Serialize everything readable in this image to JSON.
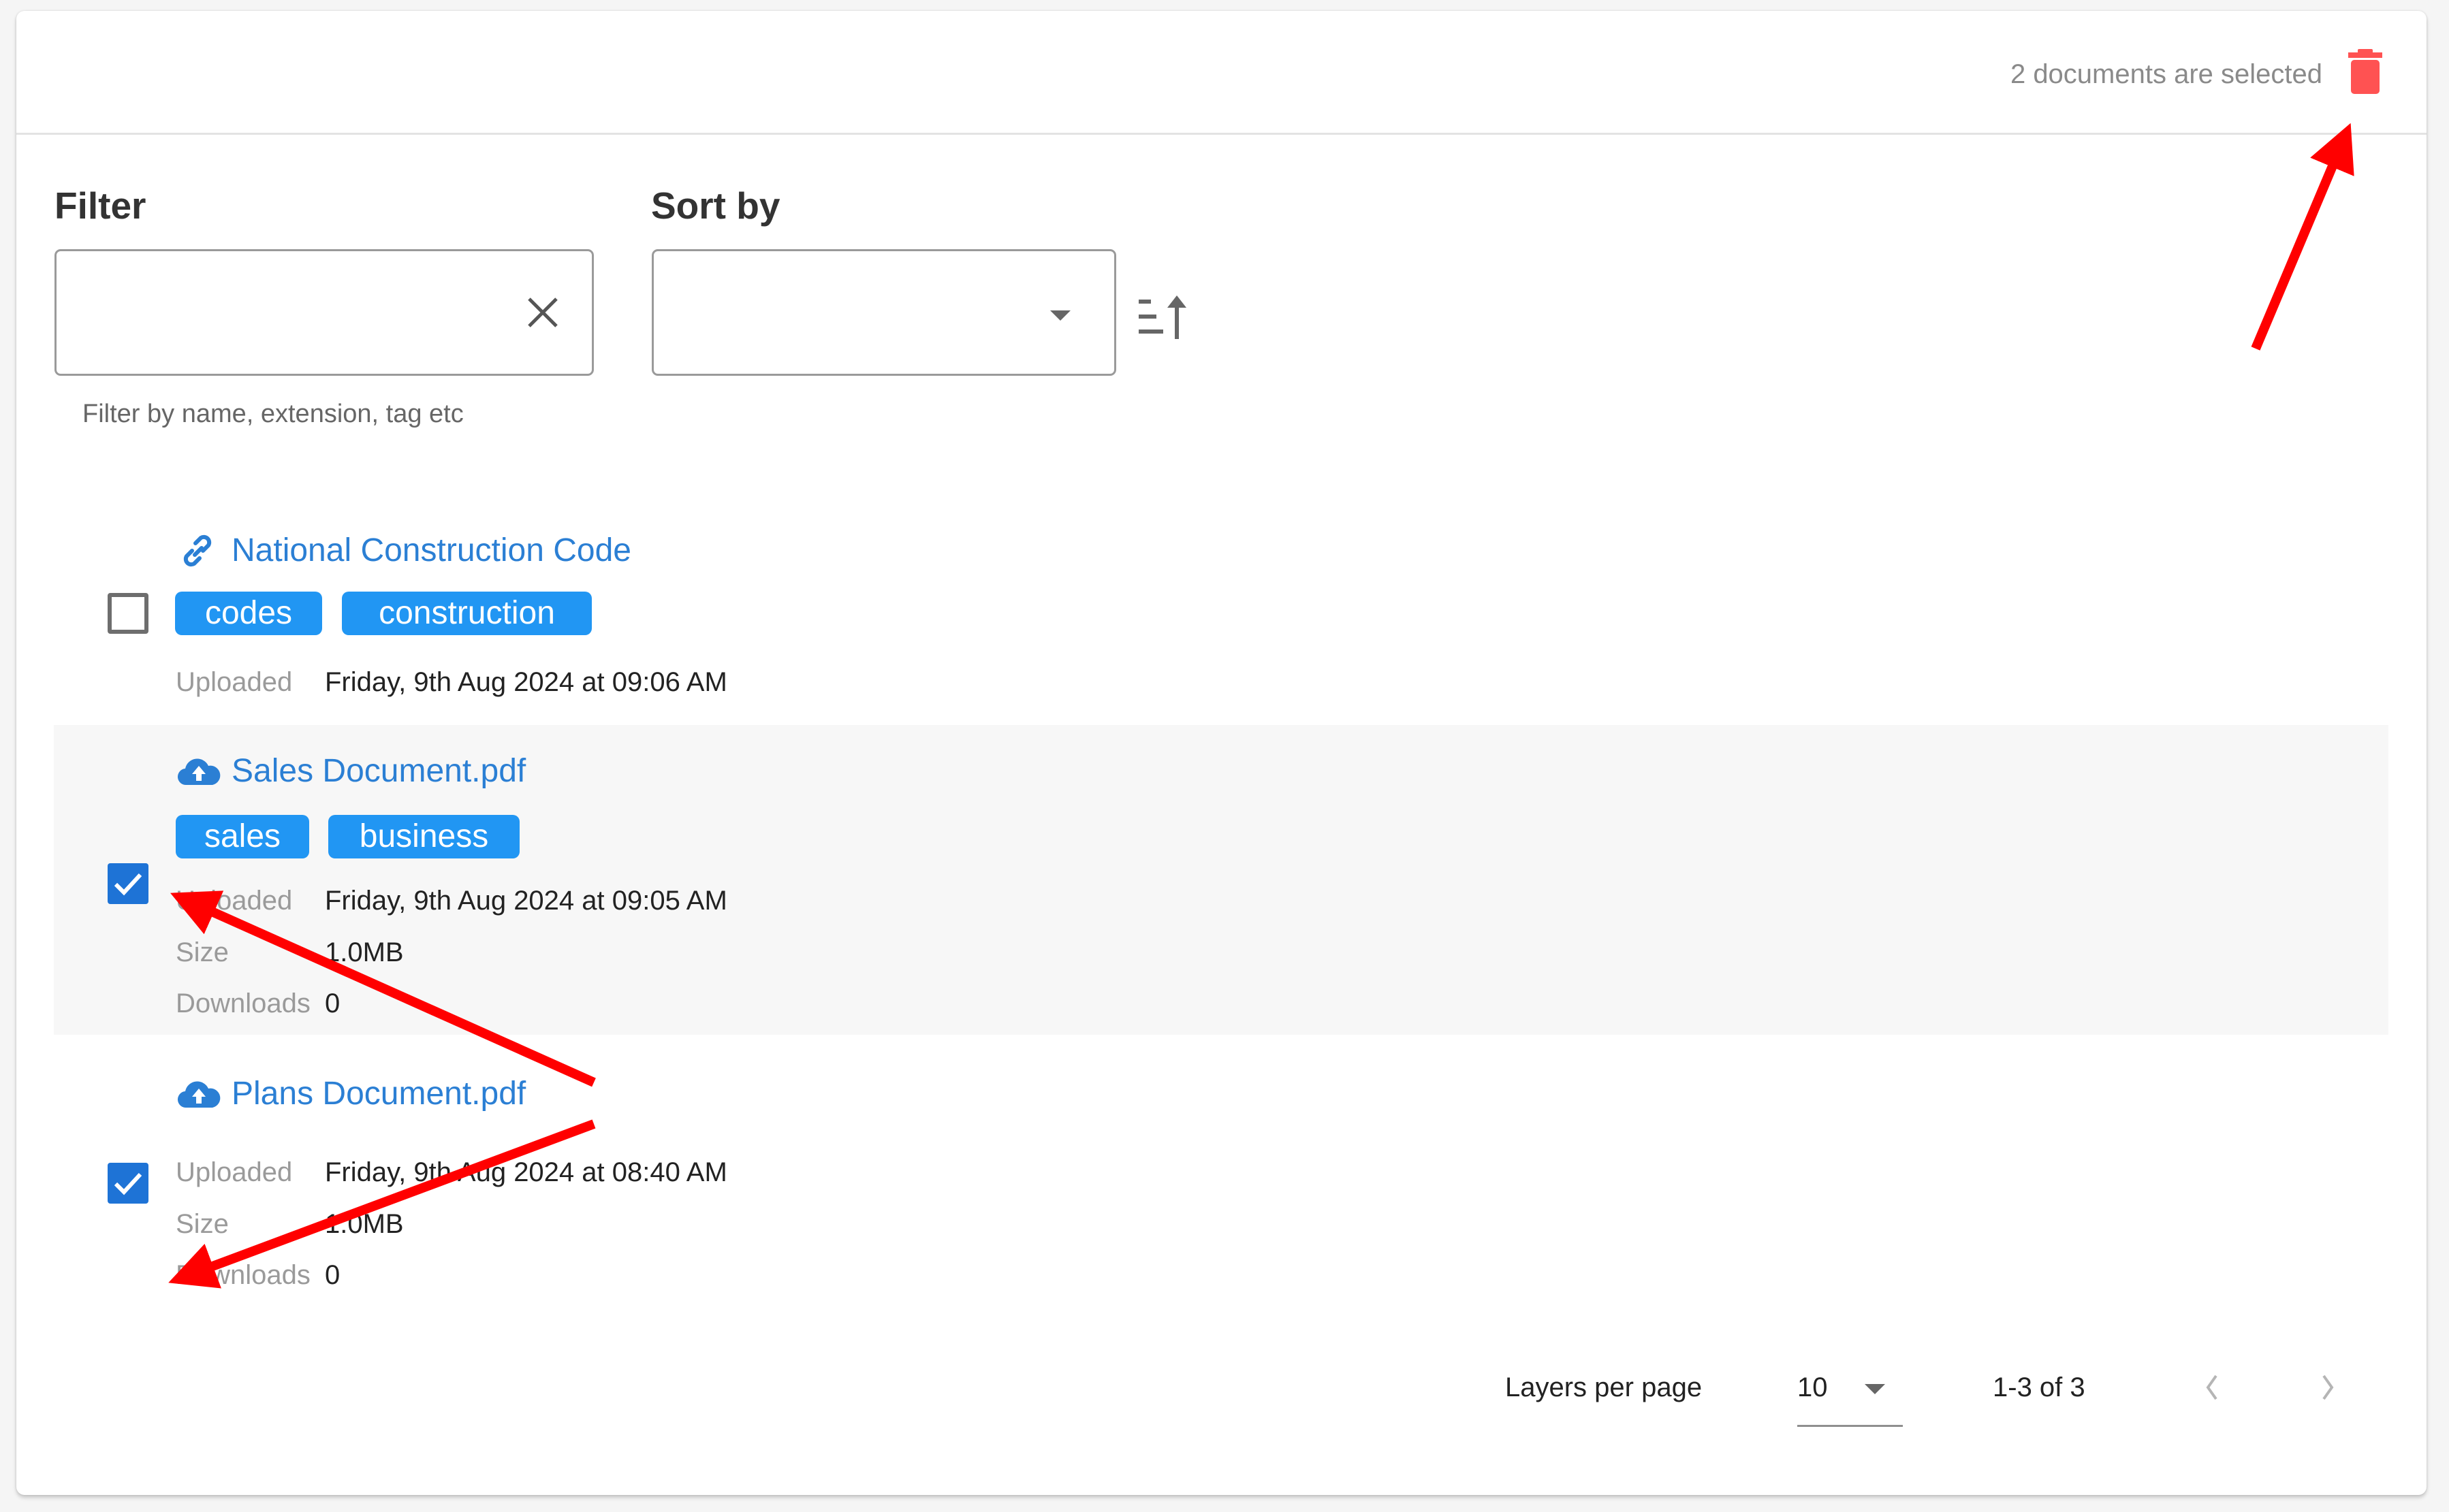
{
  "header": {
    "selection_status": "2 documents are selected",
    "delete_icon": "trash-icon",
    "delete_color": "#ff5252"
  },
  "filter": {
    "label": "Filter",
    "value": "",
    "placeholder": "",
    "helper_text": "Filter by name, extension, tag etc",
    "clear_icon": "close-icon"
  },
  "sort": {
    "label": "Sort by",
    "selected_value": "",
    "dropdown_icon": "caret-down-icon",
    "direction_icon": "sort-ascending-icon"
  },
  "documents": [
    {
      "title": "National Construction Code",
      "icon": "link-icon",
      "checked": false,
      "tags": [
        "codes",
        "construction"
      ],
      "uploaded_label": "Uploaded",
      "uploaded_value": "Friday, 9th Aug 2024 at 09:06 AM"
    },
    {
      "title": "Sales Document.pdf",
      "icon": "cloud-upload-icon",
      "checked": true,
      "tags": [
        "sales",
        "business"
      ],
      "uploaded_label": "Uploaded",
      "uploaded_value": "Friday, 9th Aug 2024 at 09:05 AM",
      "size_label": "Size",
      "size_value": "1.0MB",
      "downloads_label": "Downloads",
      "downloads_value": "0"
    },
    {
      "title": "Plans Document.pdf",
      "icon": "cloud-upload-icon",
      "checked": true,
      "tags": [],
      "uploaded_label": "Uploaded",
      "uploaded_value": "Friday, 9th Aug 2024 at 08:40 AM",
      "size_label": "Size",
      "size_value": "1.0MB",
      "downloads_label": "Downloads",
      "downloads_value": "0"
    }
  ],
  "pagination": {
    "per_page_label": "Layers per page",
    "per_page_value": "10",
    "range_text": "1-3 of 3",
    "prev_icon": "chevron-left-icon",
    "next_icon": "chevron-right-icon"
  },
  "colors": {
    "accent": "#2196f3",
    "link": "#2b7fd4",
    "checkbox_checked": "#1e73d6",
    "annotation_arrow": "#ff0000"
  },
  "annotations": {
    "arrow_count": 3,
    "arrow_targets": [
      "delete-button",
      "document-2-checkbox",
      "document-3-checkbox"
    ]
  }
}
